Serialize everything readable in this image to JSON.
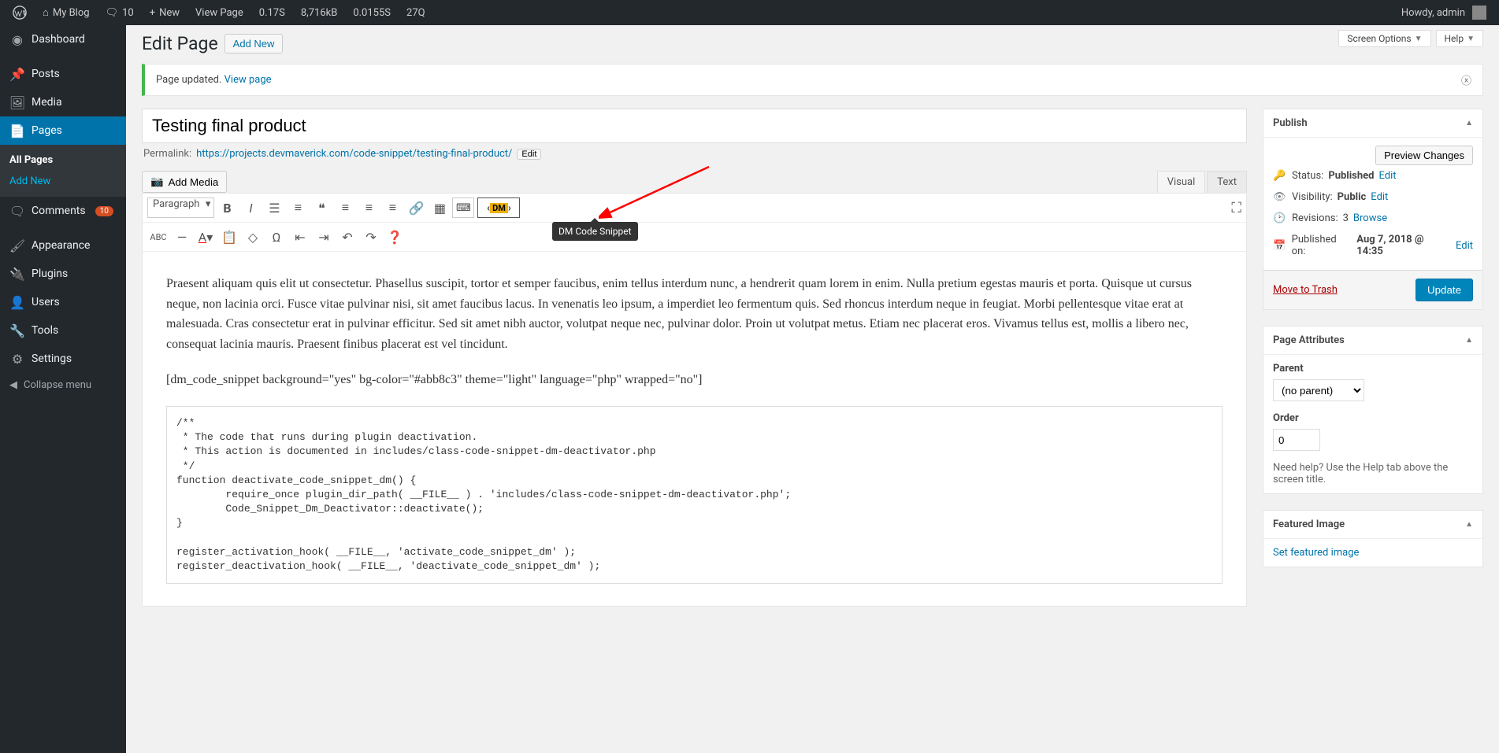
{
  "topbar": {
    "site": "My Blog",
    "comments": "10",
    "new": "New",
    "viewpage": "View Page",
    "stat1": "0.17S",
    "stat2": "8,716kB",
    "stat3": "0.0155S",
    "stat4": "27Q",
    "howdy": "Howdy, admin"
  },
  "sidebar": {
    "dashboard": "Dashboard",
    "posts": "Posts",
    "media": "Media",
    "pages": "Pages",
    "pages_all": "All Pages",
    "pages_add": "Add New",
    "comments": "Comments",
    "comments_badge": "10",
    "appearance": "Appearance",
    "plugins": "Plugins",
    "users": "Users",
    "tools": "Tools",
    "settings": "Settings",
    "collapse": "Collapse menu"
  },
  "screen": {
    "options": "Screen Options",
    "help": "Help"
  },
  "page": {
    "title": "Edit Page",
    "addnew": "Add New",
    "notice": "Page updated.",
    "viewpage": "View page",
    "titleval": "Testing final product",
    "permalink_label": "Permalink:",
    "permalink_base": "https://projects.devmaverick.com/code-snippet/",
    "permalink_slug": "testing-final-product/",
    "edit": "Edit",
    "addmedia": "Add Media",
    "tab_visual": "Visual",
    "tab_text": "Text",
    "paragraph": "Paragraph",
    "tooltip": "DM Code Snippet",
    "dm": "DM",
    "para1": "Praesent aliquam quis elit ut consectetur. Phasellus suscipit, tortor et semper faucibus, enim tellus interdum nunc, a hendrerit quam lorem in enim. Nulla pretium egestas mauris et porta. Quisque ut cursus neque, non lacinia orci. Fusce vitae pulvinar nisi, sit amet faucibus lacus. In venenatis leo ipsum, a imperdiet leo fermentum quis. Sed rhoncus interdum neque in feugiat. Morbi pellentesque vitae erat at malesuada. Cras consectetur erat in pulvinar efficitur. Sed sit amet nibh auctor, volutpat neque nec, pulvinar dolor. Proin ut volutpat metus. Etiam nec placerat eros. Vivamus tellus est, mollis a libero nec, consequat lacinia mauris. Praesent finibus placerat est vel tincidunt.",
    "para2": "[dm_code_snippet background=\"yes\" bg-color=\"#abb8c3\" theme=\"light\" language=\"php\" wrapped=\"no\"]",
    "code": "/**\n * The code that runs during plugin deactivation.\n * This action is documented in includes/class-code-snippet-dm-deactivator.php\n */\nfunction deactivate_code_snippet_dm() {\n        require_once plugin_dir_path( __FILE__ ) . 'includes/class-code-snippet-dm-deactivator.php';\n        Code_Snippet_Dm_Deactivator::deactivate();\n}\n\nregister_activation_hook( __FILE__, 'activate_code_snippet_dm' );\nregister_deactivation_hook( __FILE__, 'deactivate_code_snippet_dm' );"
  },
  "publish": {
    "title": "Publish",
    "preview": "Preview Changes",
    "status_l": "Status:",
    "status_v": "Published",
    "vis_l": "Visibility:",
    "vis_v": "Public",
    "rev_l": "Revisions:",
    "rev_v": "3",
    "browse": "Browse",
    "pub_l": "Published on:",
    "pub_v": "Aug 7, 2018 @ 14:35",
    "edit": "Edit",
    "trash": "Move to Trash",
    "update": "Update"
  },
  "attrs": {
    "title": "Page Attributes",
    "parent": "Parent",
    "noparent": "(no parent)",
    "order": "Order",
    "orderval": "0",
    "help": "Need help? Use the Help tab above the screen title."
  },
  "featured": {
    "title": "Featured Image",
    "set": "Set featured image"
  }
}
